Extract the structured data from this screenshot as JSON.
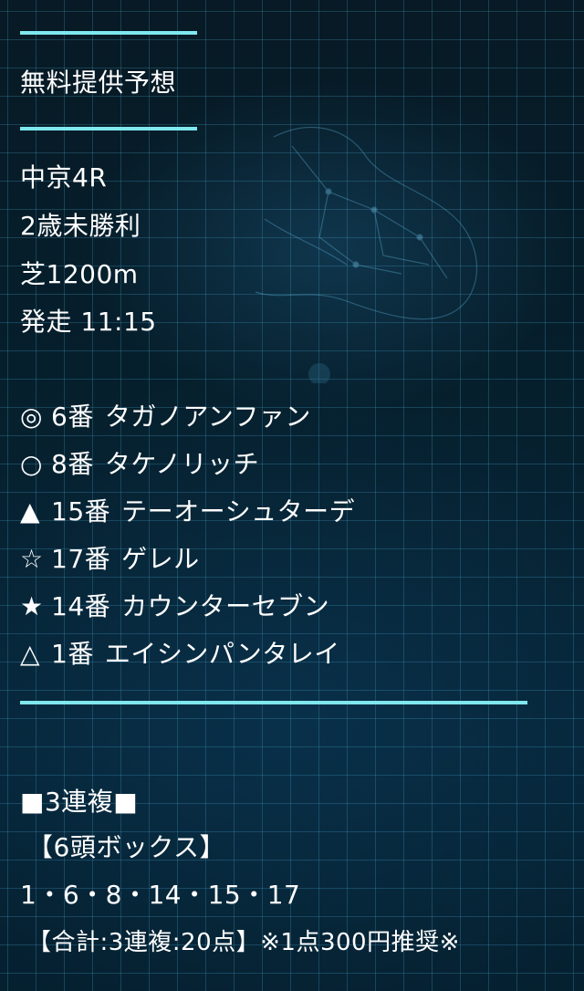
{
  "header": {
    "title": "無料提供予想"
  },
  "race": {
    "name": "中京4R",
    "class": "2歳未勝利",
    "course": "芝1200m",
    "start": "発走 11:15"
  },
  "picks": [
    {
      "mark": "◎",
      "num": "6番",
      "horse": "タガノアンファン"
    },
    {
      "mark": "○",
      "num": "8番",
      "horse": "タケノリッチ"
    },
    {
      "mark": "▲",
      "num": "15番",
      "horse": "テーオーシュターデ"
    },
    {
      "mark": "☆",
      "num": "17番",
      "horse": "ゲレル"
    },
    {
      "mark": "★",
      "num": "14番",
      "horse": "カウンターセブン"
    },
    {
      "mark": "△",
      "num": "1番",
      "horse": "エイシンパンタレイ"
    }
  ],
  "bet": {
    "type": "■3連複■",
    "format": "【6頭ボックス】",
    "numbers": "1・6・8・14・15・17",
    "total": "【合計:3連複:20点】※1点300円推奨※"
  },
  "colors": {
    "accent": "#7fe7ee",
    "background": "#061621",
    "grid": "#3c8fb4"
  }
}
